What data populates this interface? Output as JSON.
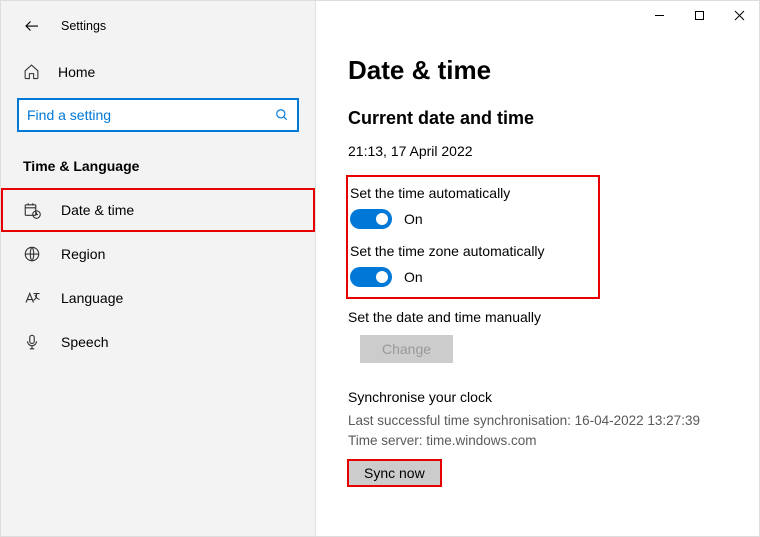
{
  "window": {
    "title": "Settings"
  },
  "sidebar": {
    "home": "Home",
    "search_placeholder": "Find a setting",
    "section": "Time & Language",
    "items": [
      {
        "label": "Date & time"
      },
      {
        "label": "Region"
      },
      {
        "label": "Language"
      },
      {
        "label": "Speech"
      }
    ]
  },
  "page": {
    "title": "Date & time",
    "subtitle": "Current date and time",
    "current": "21:13, 17 April 2022",
    "auto_time_label": "Set the time automatically",
    "auto_time_state": "On",
    "auto_tz_label": "Set the time zone automatically",
    "auto_tz_state": "On",
    "manual_label": "Set the date and time manually",
    "change_btn": "Change",
    "sync_title": "Synchronise your clock",
    "sync_last": "Last successful time synchronisation: 16-04-2022 13:27:39",
    "sync_server": "Time server: time.windows.com",
    "sync_btn": "Sync now"
  }
}
